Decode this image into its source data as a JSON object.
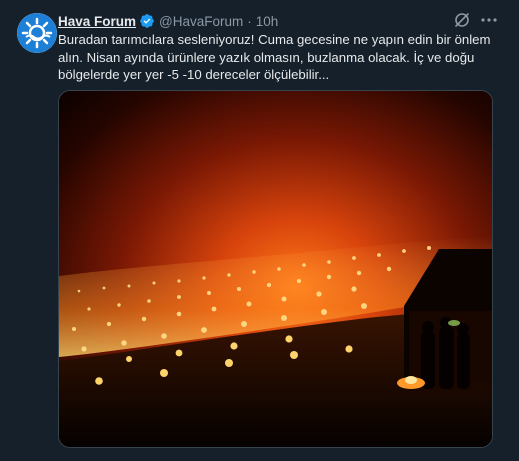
{
  "tweet": {
    "display_name": "Hava Forum",
    "handle": "@HavaForum",
    "separator": "·",
    "time": "10h",
    "text": "Buradan tarımcılara sesleniyoruz! Cuma gecesine ne yapın edin bir önlem alın. Nisan ayında ürünlere yazık olmasın, buzlanma olacak. İç ve doğu bölgelerde yer yer -5 -10 dereceler ölçülebilir..."
  },
  "icons": {
    "avatar": "hava-forum-logo",
    "verified": "verified-badge-icon",
    "grok": "grok-icon",
    "more": "more-icon"
  },
  "colors": {
    "background": "#15202b",
    "verified": "#1d9bf0",
    "secondary_text": "#8b98a5",
    "logo": "#1d7fd6"
  }
}
